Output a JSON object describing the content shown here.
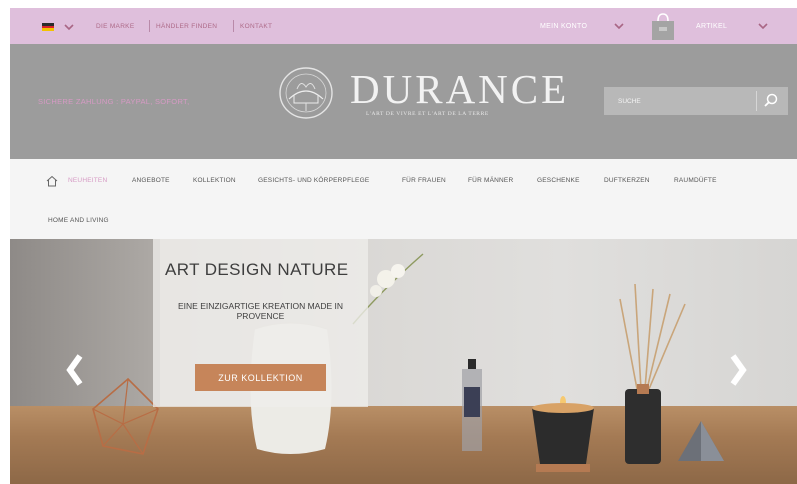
{
  "topbar": {
    "links": [
      "DIE MARKE",
      "HÄNDLER FINDEN",
      "KONTAKT"
    ],
    "account_label": "MEIN KONTO",
    "cart_label": "ARTIKEL"
  },
  "header": {
    "payment_text": "SICHERE ZAHLUNG : PAYPAL, SOFORT,",
    "brand": "DURANCE",
    "tagline": "L'ART DE VIVRE ET L'ART DE LA TERRE",
    "search_placeholder": "SUCHE"
  },
  "nav": {
    "items": [
      "NEUHEITEN",
      "ANGEBOTE",
      "KOLLEKTION",
      "GESICHTS- UND KÖRPERPFLEGE",
      "FÜR FRAUEN",
      "FÜR MÄNNER",
      "GESCHENKE",
      "DUFTKERZEN",
      "RAUMDÜFTE",
      "HOME AND LIVING"
    ]
  },
  "hero": {
    "title": "ART DESIGN NATURE",
    "subtitle": "EINE EINZIGARTIGE KREATION MADE IN PROVENCE",
    "cta_label": "ZUR KOLLEKTION"
  },
  "colors": {
    "topbar_bg": "#dfbfdc",
    "header_bg": "#9c9c9c",
    "accent_pink": "#d69ac4",
    "cta_copper": "#c6855a",
    "nav_active": "#d69ac4"
  },
  "icons": [
    "flag-germany-icon",
    "chevron-down-icon",
    "shopping-bag-icon",
    "search-icon",
    "home-icon",
    "chevron-left-icon",
    "chevron-right-icon"
  ]
}
